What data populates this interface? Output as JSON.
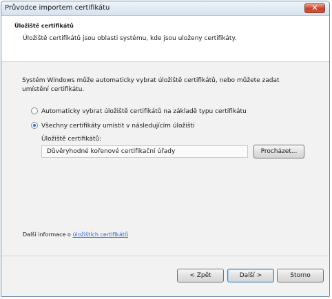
{
  "window": {
    "title": "Průvodce importem certifikátu"
  },
  "header": {
    "title": "Úložiště certifikátů",
    "description": "Úložiště certifikátů jsou oblasti systému, kde jsou uloženy certifikáty."
  },
  "content": {
    "intro": "Systém Windows může automaticky vybrat úložiště certifikátů, nebo můžete zadat umístění certifikátu.",
    "options": [
      {
        "label": "Automaticky vybrat úložiště certifikátů na základě typu certifikátu",
        "selected": false
      },
      {
        "label": "Všechny certifikáty umístit v následujícím úložišti",
        "selected": true
      }
    ],
    "store_label": "Úložiště certifikátů:",
    "store_value": "Důvěryhodné kořenové certifikační úřady",
    "browse_label": "Procházet...",
    "more_info_prefix": "Další informace o ",
    "more_info_link": "úložištích certifikátů"
  },
  "footer": {
    "back_label": "< Zpět",
    "next_label": "Další >",
    "cancel_label": "Storno"
  },
  "colors": {
    "accent": "#2a6fc9",
    "link": "#3366cc",
    "close_button": "#c5432b"
  }
}
